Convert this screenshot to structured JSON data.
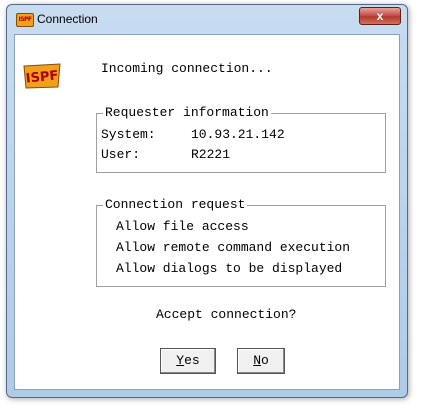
{
  "window": {
    "title": "Connection",
    "app_icon_text": "ISPF",
    "close_label": "x"
  },
  "message": {
    "incoming": "Incoming connection..."
  },
  "requester": {
    "legend": "Requester information",
    "rows": [
      {
        "label": "System:",
        "value": "10.93.21.142"
      },
      {
        "label": "User:",
        "value": "R2221"
      }
    ]
  },
  "connection_request": {
    "legend": "Connection request",
    "items": [
      "Allow file access",
      "Allow remote command execution",
      "Allow dialogs to be displayed"
    ]
  },
  "prompt": "Accept connection?",
  "buttons": {
    "yes": {
      "mnemonic": "Y",
      "rest": "es"
    },
    "no": {
      "mnemonic": "N",
      "rest": "o"
    }
  },
  "colors": {
    "title_gradient_top": "#c8dcf0",
    "close_button": "#c75050",
    "logo_fill": "#f0a01c",
    "logo_text": "#b00000"
  }
}
